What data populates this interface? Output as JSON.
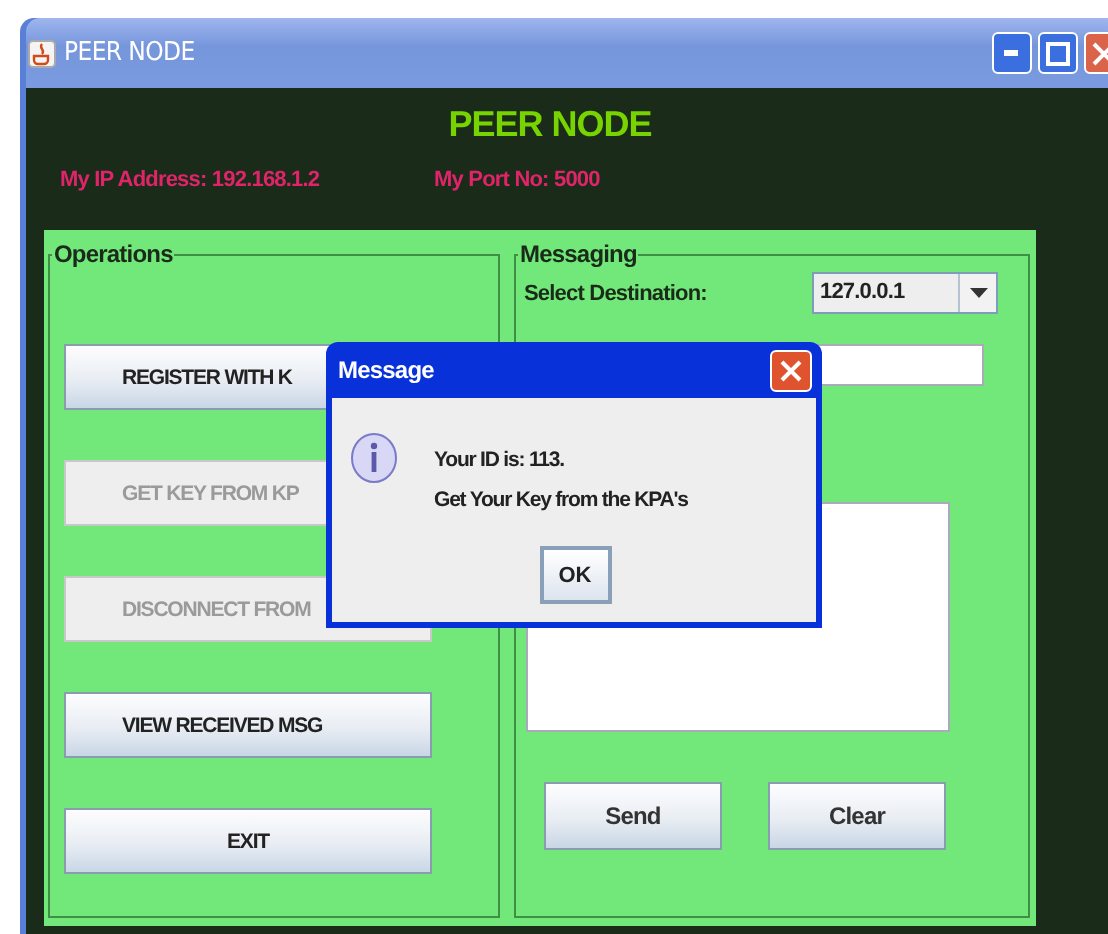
{
  "window": {
    "title": "PEER NODE"
  },
  "header": {
    "title": "PEER NODE",
    "ip": "My IP Address: 192.168.1.2",
    "port": "My Port No: 5000"
  },
  "operations": {
    "title": "Operations",
    "buttons": [
      {
        "label": "REGISTER WITH K",
        "disabled": false
      },
      {
        "label": "GET KEY FROM KP",
        "disabled": true
      },
      {
        "label": "DISCONNECT FROM",
        "disabled": true
      },
      {
        "label": "VIEW RECEIVED MSG",
        "disabled": false
      },
      {
        "label": "EXIT",
        "disabled": false
      }
    ]
  },
  "messaging": {
    "title": "Messaging",
    "destination_label": "Select Destination:",
    "destination": "127.0.0.1",
    "buttons": [
      "Send",
      "Clear"
    ]
  },
  "dialog": {
    "title": "Message",
    "lines": [
      "Your ID is: 113.",
      "Get Your Key from the KPA's"
    ],
    "ok": "OK"
  }
}
